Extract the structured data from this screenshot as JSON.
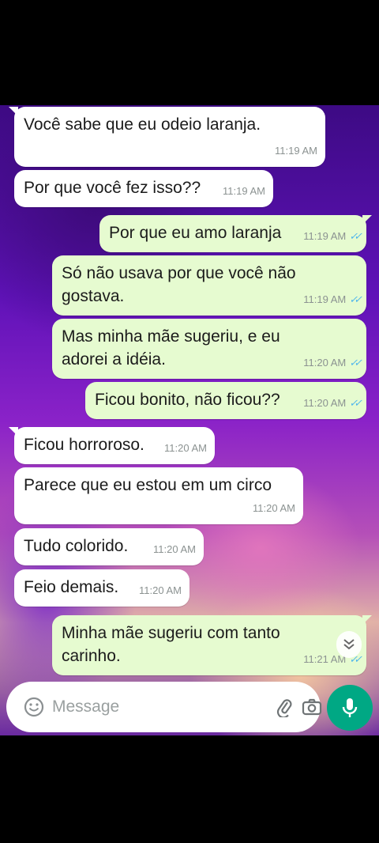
{
  "messages": [
    {
      "text": "Você sabe que eu odeio laranja.",
      "time": "11:19 AM",
      "direction": "in"
    },
    {
      "text": "Por que você fez isso??",
      "time": "11:19 AM",
      "direction": "in"
    },
    {
      "text": "Por que eu amo laranja",
      "time": "11:19 AM",
      "direction": "out"
    },
    {
      "text": "Só não usava por que você não gostava.",
      "time": "11:19 AM",
      "direction": "out"
    },
    {
      "text": "Mas minha mãe sugeriu, e eu adorei a idéia.",
      "time": "11:20 AM",
      "direction": "out"
    },
    {
      "text": "Ficou bonito, não ficou??",
      "time": "11:20 AM",
      "direction": "out"
    },
    {
      "text": "Ficou horroroso.",
      "time": "11:20 AM",
      "direction": "in"
    },
    {
      "text": "Parece que eu estou em um circo",
      "time": "11:20 AM",
      "direction": "in"
    },
    {
      "text": "Tudo colorido.",
      "time": "11:20 AM",
      "direction": "in"
    },
    {
      "text": "Feio demais.",
      "time": "11:20 AM",
      "direction": "in"
    },
    {
      "text": "Minha mãe sugeriu com tanto carinho.",
      "time": "11:21 AM",
      "direction": "out"
    }
  ],
  "composer": {
    "placeholder": "Message",
    "icons": [
      "emoji-icon",
      "attach-icon",
      "camera-icon",
      "mic-icon"
    ]
  },
  "colors": {
    "incoming": "#ffffff",
    "outgoing": "#e6fbd0",
    "read_ticks": "#4fb6ec",
    "mic_button": "#00a884"
  }
}
